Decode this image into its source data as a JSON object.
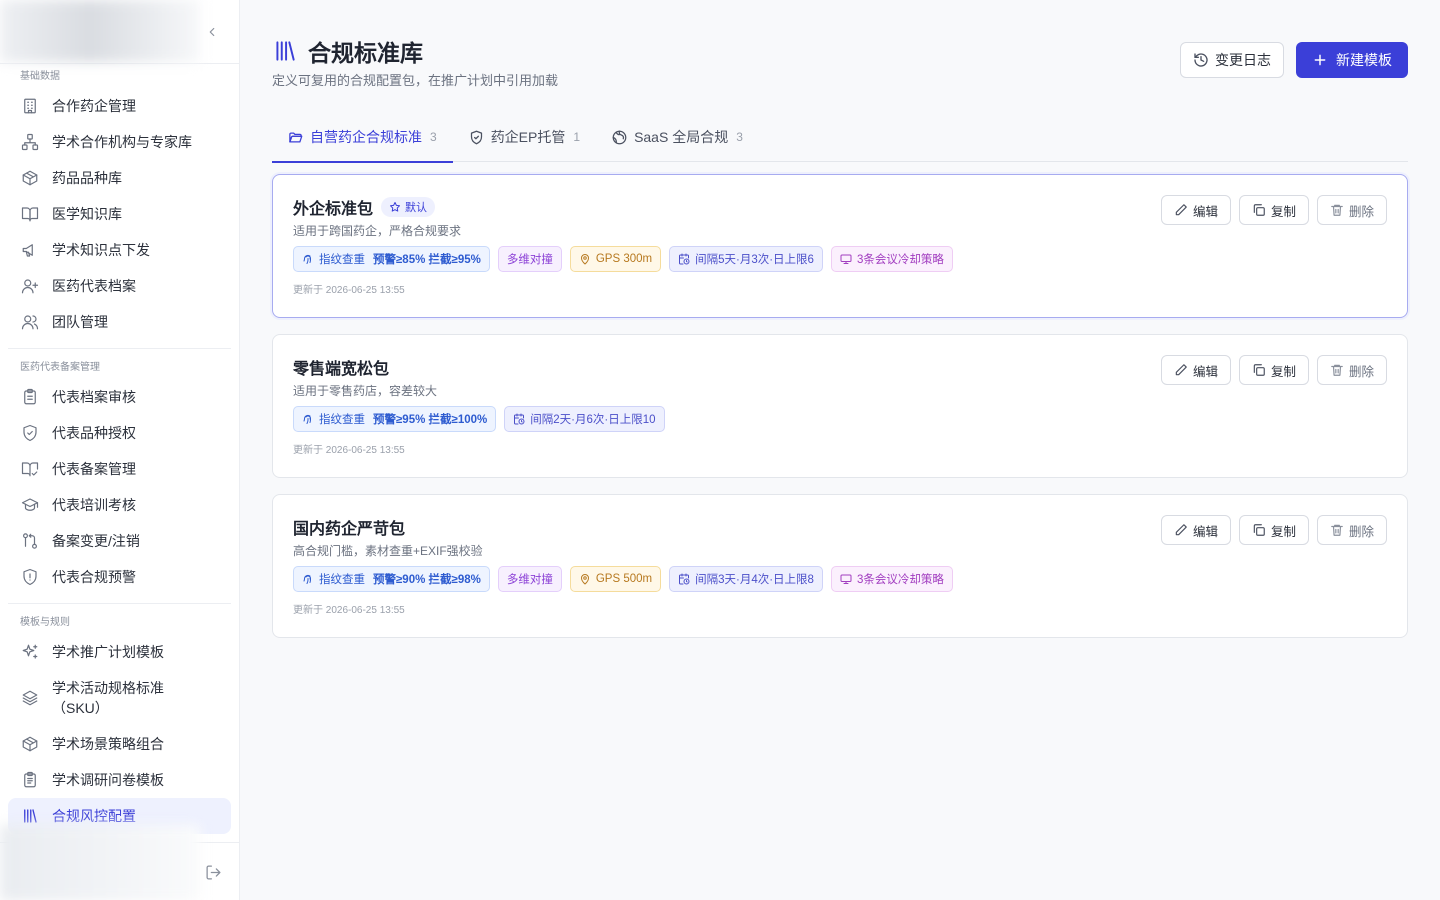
{
  "sidebar": {
    "groups": [
      {
        "title": "基础数据",
        "items": [
          {
            "label": "合作药企管理",
            "icon": "building-icon"
          },
          {
            "label": "学术合作机构与专家库",
            "icon": "network-icon"
          },
          {
            "label": "药品品种库",
            "icon": "box-icon"
          },
          {
            "label": "医学知识库",
            "icon": "book-open-icon"
          },
          {
            "label": "学术知识点下发",
            "icon": "megaphone-icon"
          },
          {
            "label": "医药代表档案",
            "icon": "user-plus-icon"
          },
          {
            "label": "团队管理",
            "icon": "users-icon"
          }
        ]
      },
      {
        "title": "医药代表备案管理",
        "items": [
          {
            "label": "代表档案审核",
            "icon": "clipboard-list-icon"
          },
          {
            "label": "代表品种授权",
            "icon": "shield-check-icon"
          },
          {
            "label": "代表备案管理",
            "icon": "book-check-icon"
          },
          {
            "label": "代表培训考核",
            "icon": "graduation-cap-icon"
          },
          {
            "label": "备案变更/注销",
            "icon": "git-compare-icon"
          },
          {
            "label": "代表合规预警",
            "icon": "shield-alert-icon"
          }
        ]
      },
      {
        "title": "模板与规则",
        "items": [
          {
            "label": "学术推广计划模板",
            "icon": "sparkles-icon"
          },
          {
            "label": "学术活动规格标准（SKU）",
            "label_line1": "学术活动规格标准",
            "label_line2": "（SKU）",
            "icon": "layers-icon"
          },
          {
            "label": "学术场景策略组合",
            "icon": "box-icon"
          },
          {
            "label": "学术调研问卷模板",
            "icon": "clipboard-icon"
          },
          {
            "label": "合规风控配置",
            "icon": "library-icon",
            "active": true
          }
        ]
      }
    ]
  },
  "header": {
    "title": "合规标准库",
    "subtitle": "定义可复用的合规配置包，在推广计划中引用加载",
    "changelog_label": "变更日志",
    "new_template_label": "新建模板"
  },
  "tabs": [
    {
      "label": "自营药企合规标准",
      "count": "3",
      "icon": "folder-open-icon",
      "active": true
    },
    {
      "label": "药企EP托管",
      "count": "1",
      "icon": "shield-icon",
      "active": false
    },
    {
      "label": "SaaS 全局合规",
      "count": "3",
      "icon": "globe-icon",
      "active": false
    }
  ],
  "card_actions": {
    "edit": "编辑",
    "copy": "复制",
    "delete": "删除"
  },
  "templates": [
    {
      "name": "外企标准包",
      "default_badge": "默认",
      "desc": "适用于跨国药企，严格合规要求",
      "fingerprint": {
        "label": "指纹查重",
        "value": "预警≥85% 拦截≥95%"
      },
      "multi": "多维对撞",
      "gps": "GPS 300m",
      "interval": "间隔5天·月3次·日上限6",
      "meeting": "3条会议冷却策略",
      "updated": "更新于 2026-06-25 13:55"
    },
    {
      "name": "零售端宽松包",
      "desc": "适用于零售药店，容差较大",
      "fingerprint": {
        "label": "指纹查重",
        "value": "预警≥95% 拦截≥100%"
      },
      "interval": "间隔2天·月6次·日上限10",
      "updated": "更新于 2026-06-25 13:55"
    },
    {
      "name": "国内药企严苛包",
      "desc": "高合规门槛，素材查重+EXIF强校验",
      "fingerprint": {
        "label": "指纹查重",
        "value": "预警≥90% 拦截≥98%"
      },
      "multi": "多维对撞",
      "gps": "GPS 500m",
      "interval": "间隔3天·月4次·日上限8",
      "meeting": "3条会议冷却策略",
      "updated": "更新于 2026-06-25 13:55"
    }
  ],
  "colors": {
    "accent": "#3b3fd8",
    "background": "#f8f9fb"
  }
}
